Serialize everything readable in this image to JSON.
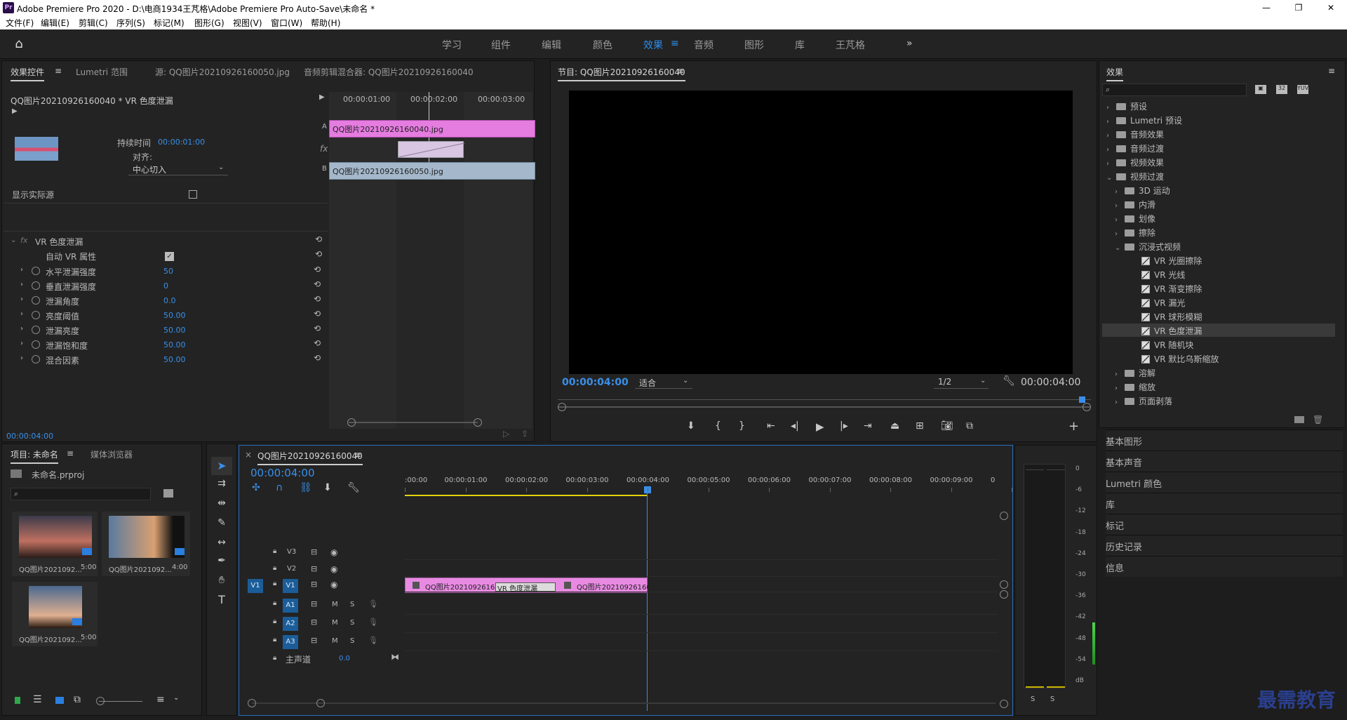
{
  "window": {
    "title": "Adobe Premiere Pro 2020 - D:\\电商1934王芃格\\Adobe Premiere Pro Auto-Save\\未命名 *",
    "minimize": "—",
    "maximize": "❐",
    "close": "✕",
    "logo": "Pr"
  },
  "menu": [
    "文件(F)",
    "编辑(E)",
    "剪辑(C)",
    "序列(S)",
    "标记(M)",
    "图形(G)",
    "视图(V)",
    "窗口(W)",
    "帮助(H)"
  ],
  "workspaces": [
    "学习",
    "组件",
    "编辑",
    "颜色",
    "效果",
    "音频",
    "图形",
    "库",
    "王芃格"
  ],
  "active_workspace": "效果",
  "effect_controls": {
    "tabs": [
      "效果控件",
      "Lumetri 范围",
      "源: QQ图片20210926160050.jpg",
      "音频剪辑混合器: QQ图片20210926160040"
    ],
    "clip_label": "QQ图片20210926160040 * VR 色度泄漏",
    "ruler": [
      "00:00:01:00",
      "00:00:02:00",
      "00:00:03:00"
    ],
    "track_a": "A",
    "track_b": "B",
    "clip_a": "QQ图片20210926160040.jpg",
    "clip_b": "QQ图片20210926160050.jpg",
    "duration_label": "持续时间",
    "duration_value": "00:00:01:00",
    "align_label": "对齐:",
    "align_value": "中心切入",
    "show_source": "显示实际源",
    "effect_name": "VR 色度泄漏",
    "auto_vr": "自动 VR 属性",
    "params": [
      {
        "name": "水平泄漏强度",
        "value": "50"
      },
      {
        "name": "垂直泄漏强度",
        "value": "0"
      },
      {
        "name": "泄漏角度",
        "value": "0.0"
      },
      {
        "name": "亮度阈值",
        "value": "50.00"
      },
      {
        "name": "泄漏亮度",
        "value": "50.00"
      },
      {
        "name": "泄漏饱和度",
        "value": "50.00"
      },
      {
        "name": "混合因素",
        "value": "50.00"
      }
    ],
    "time": "00:00:04:00"
  },
  "program": {
    "title": "节目: QQ图片20210926160040",
    "timecode": "00:00:04:00",
    "fit": "适合",
    "resolution": "1/2",
    "duration": "00:00:04:00"
  },
  "effects_panel": {
    "title": "效果",
    "tree": [
      {
        "label": "预设",
        "level": 0,
        "type": "folder",
        "open": false
      },
      {
        "label": "Lumetri 预设",
        "level": 0,
        "type": "folder",
        "open": false
      },
      {
        "label": "音频效果",
        "level": 0,
        "type": "folder",
        "open": false
      },
      {
        "label": "音频过渡",
        "level": 0,
        "type": "folder",
        "open": false
      },
      {
        "label": "视频效果",
        "level": 0,
        "type": "folder",
        "open": false
      },
      {
        "label": "视频过渡",
        "level": 0,
        "type": "folder",
        "open": true
      },
      {
        "label": "3D 运动",
        "level": 1,
        "type": "folder",
        "open": false
      },
      {
        "label": "内滑",
        "level": 1,
        "type": "folder",
        "open": false
      },
      {
        "label": "划像",
        "level": 1,
        "type": "folder",
        "open": false
      },
      {
        "label": "擦除",
        "level": 1,
        "type": "folder",
        "open": false
      },
      {
        "label": "沉浸式视频",
        "level": 1,
        "type": "folder",
        "open": true
      },
      {
        "label": "VR 光圈擦除",
        "level": 2,
        "type": "fx"
      },
      {
        "label": "VR 光线",
        "level": 2,
        "type": "fx"
      },
      {
        "label": "VR 渐变擦除",
        "level": 2,
        "type": "fx"
      },
      {
        "label": "VR 漏光",
        "level": 2,
        "type": "fx"
      },
      {
        "label": "VR 球形模糊",
        "level": 2,
        "type": "fx"
      },
      {
        "label": "VR 色度泄漏",
        "level": 2,
        "type": "fx",
        "selected": true
      },
      {
        "label": "VR 随机块",
        "level": 2,
        "type": "fx"
      },
      {
        "label": "VR 默比乌斯缩放",
        "level": 2,
        "type": "fx"
      },
      {
        "label": "溶解",
        "level": 1,
        "type": "folder",
        "open": false
      },
      {
        "label": "缩放",
        "level": 1,
        "type": "folder",
        "open": false
      },
      {
        "label": "页面剥落",
        "level": 1,
        "type": "folder",
        "open": false
      }
    ],
    "sections": [
      "基本图形",
      "基本声音",
      "Lumetri 颜色",
      "库",
      "标记",
      "历史记录",
      "信息"
    ]
  },
  "project": {
    "tabs": [
      "项目: 未命名",
      "媒体浏览器"
    ],
    "file": "未命名.prproj",
    "items": [
      {
        "name": "QQ图片2021092...",
        "dur": "5:00"
      },
      {
        "name": "QQ图片2021092...",
        "dur": "4:00"
      },
      {
        "name": "QQ图片2021092...",
        "dur": "5:00"
      }
    ]
  },
  "timeline": {
    "tab": "QQ图片20210926160040",
    "timecode": "00:00:04:00",
    "ruler": [
      ":00:00",
      "00:00:01:00",
      "00:00:02:00",
      "00:00:03:00",
      "00:00:04:00",
      "00:00:05:00",
      "00:00:06:00",
      "00:00:07:00",
      "00:00:08:00",
      "00:00:09:00",
      "0"
    ],
    "tracks_v": [
      "V3",
      "V2",
      "V1"
    ],
    "tracks_a": [
      "A1",
      "A2",
      "A3"
    ],
    "src_v1": "V1",
    "master": "主声道",
    "master_val": "0.0",
    "clip1": "QQ图片20210926160",
    "clip2": "QQ图片20210926160",
    "transition": "VR 色度泄漏",
    "m": "M",
    "s": "S"
  },
  "meter": {
    "scale": [
      "0",
      "-6",
      "-12",
      "-18",
      "-24",
      "-30",
      "-36",
      "-42",
      "-48",
      "-54",
      "dB"
    ],
    "s": "S"
  },
  "watermark": "最需教育"
}
